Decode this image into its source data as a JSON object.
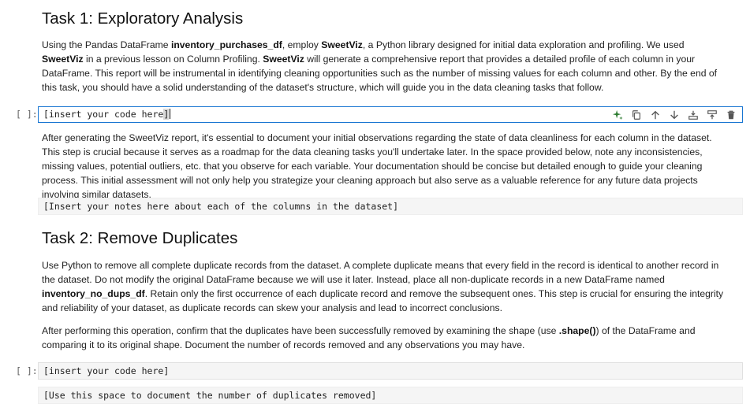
{
  "task1": {
    "heading": "Task 1: Exploratory Analysis",
    "intro_1": "Using the Pandas DataFrame ",
    "intro_b1": "inventory_purchases_df",
    "intro_2": ", employ ",
    "intro_b2": "SweetViz",
    "intro_3": ", a Python library designed for initial data exploration and profiling. We used ",
    "intro_b3": "SweetViz",
    "intro_4": " in a previous lesson on Column Profiling. ",
    "intro_b4": "SweetViz",
    "intro_5": " will generate a comprehensive report that provides a detailed profile of each column in your DataFrame. This report will be instrumental in identifying cleaning opportunities such as the number of missing values for each column and other. By the end of this task, you should have a solid understanding of the dataset's structure, which will guide you in the data cleaning tasks that follow.",
    "code_prompt": "[ ]:",
    "code_text": "[insert your code here",
    "code_close": "]",
    "after_text": "After generating the SweetViz report, it's essential to document your initial observations regarding the state of data cleanliness for each column in the dataset. This step is crucial because it serves as a roadmap for the data cleaning tasks you'll undertake later. In the space provided below, note any inconsistencies, missing values, potential outliers, etc. that you observe for each variable. Your documentation should be concise but detailed enough to guide your cleaning process. This initial assessment will not only help you strategize your cleaning approach but also serve as a valuable reference for any future data projects involving similar datasets.",
    "notes_text": "[Insert your notes here about each of the columns in the dataset]"
  },
  "task2": {
    "heading": "Task 2: Remove Duplicates",
    "p1_a": "Use Python to remove all complete duplicate records from the dataset. A complete duplicate means that every field in the record is identical to another record in the dataset. Do not modify the original DataFrame because we will use it later. Instead, place all non-duplicate records in a new DataFrame named ",
    "p1_b": "inventory_no_dups_df",
    "p1_c": ". Retain only the first occurrence of each duplicate record and remove the subsequent ones. This step is crucial for ensuring the integrity and reliability of your dataset, as duplicate records can skew your analysis and lead to incorrect conclusions.",
    "p2_a": "After performing this operation, confirm that the duplicates have been successfully removed by examining the shape (use ",
    "p2_b": ".shape()",
    "p2_c": ") of the DataFrame and comparing it to its original shape. Document the number of records removed and any observations you may have.",
    "code_prompt": "[ ]:",
    "code_text": "[insert your code here]",
    "doc_text": "[Use this space to document the number of duplicates removed]"
  },
  "toolbar": {
    "icons": [
      "sparkle-icon",
      "copy-icon",
      "arrow-up-icon",
      "arrow-down-icon",
      "insert-below-icon",
      "insert-above-icon",
      "trash-icon"
    ]
  }
}
